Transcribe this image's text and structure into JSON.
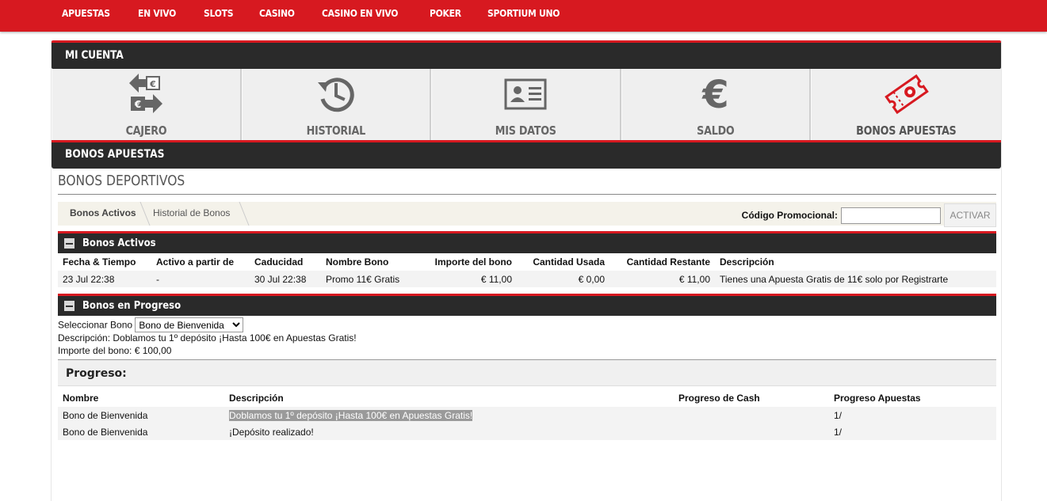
{
  "nav": [
    "APUESTAS",
    "EN VIVO",
    "SLOTS",
    "CASINO",
    "CASINO EN VIVO",
    "POKER",
    "SPORTIUM UNO"
  ],
  "account": {
    "title": "MI CUENTA",
    "tiles": [
      {
        "label": "CAJERO",
        "icon": "cashier-exchange-icon"
      },
      {
        "label": "HISTORIAL",
        "icon": "history-clock-icon"
      },
      {
        "label": "MIS DATOS",
        "icon": "id-card-icon"
      },
      {
        "label": "SALDO",
        "icon": "euro-icon"
      },
      {
        "label": "BONOS APUESTAS",
        "icon": "bet-ticket-icon"
      }
    ],
    "section_bar": "BONOS APUESTAS"
  },
  "bonos": {
    "title": "BONOS DEPORTIVOS",
    "tabs": [
      "Bonos Activos",
      "Historial de Bonos"
    ],
    "promo_label": "Código Promocional:",
    "promo_value": "",
    "activate_label": "ACTIVAR",
    "active": {
      "title": "Bonos Activos",
      "headers": [
        "Fecha & Tiempo",
        "Activo a partir de",
        "Caducidad",
        "Nombre Bono",
        "Importe del bono",
        "Cantidad Usada",
        "Cantidad Restante",
        "Descripción"
      ],
      "rows": [
        [
          "23 Jul 22:38",
          "-",
          "30 Jul 22:38",
          "Promo 11€ Gratis",
          "€ 11,00",
          "€ 0,00",
          "€ 11,00",
          "Tienes una Apuesta Gratis de 11€ solo por Registrarte"
        ]
      ]
    },
    "progress": {
      "title": "Bonos en Progreso",
      "select_label": "Seleccionar Bono",
      "select_value": "Bono de Bienvenida",
      "description": "Descripción: Doblamos tu 1º depósito ¡Hasta 100€ en Apuestas Gratis!",
      "amount": "Importe del bono: € 100,00",
      "progreso_label": "Progreso:",
      "headers": [
        "Nombre",
        "Descripción",
        "Progreso de Cash",
        "Progreso Apuestas"
      ],
      "rows": [
        [
          "Bono de Bienvenida",
          "Doblamos tu 1º depósito ¡Hasta 100€ en Apuestas Gratis!",
          "",
          "1/"
        ],
        [
          "Bono de Bienvenida",
          "¡Depósito realizado!",
          "",
          "1/"
        ]
      ]
    }
  },
  "colors": {
    "brand_red": "#d71920",
    "dark_bar": "#2a2a2a",
    "icon_gray": "#666666"
  }
}
